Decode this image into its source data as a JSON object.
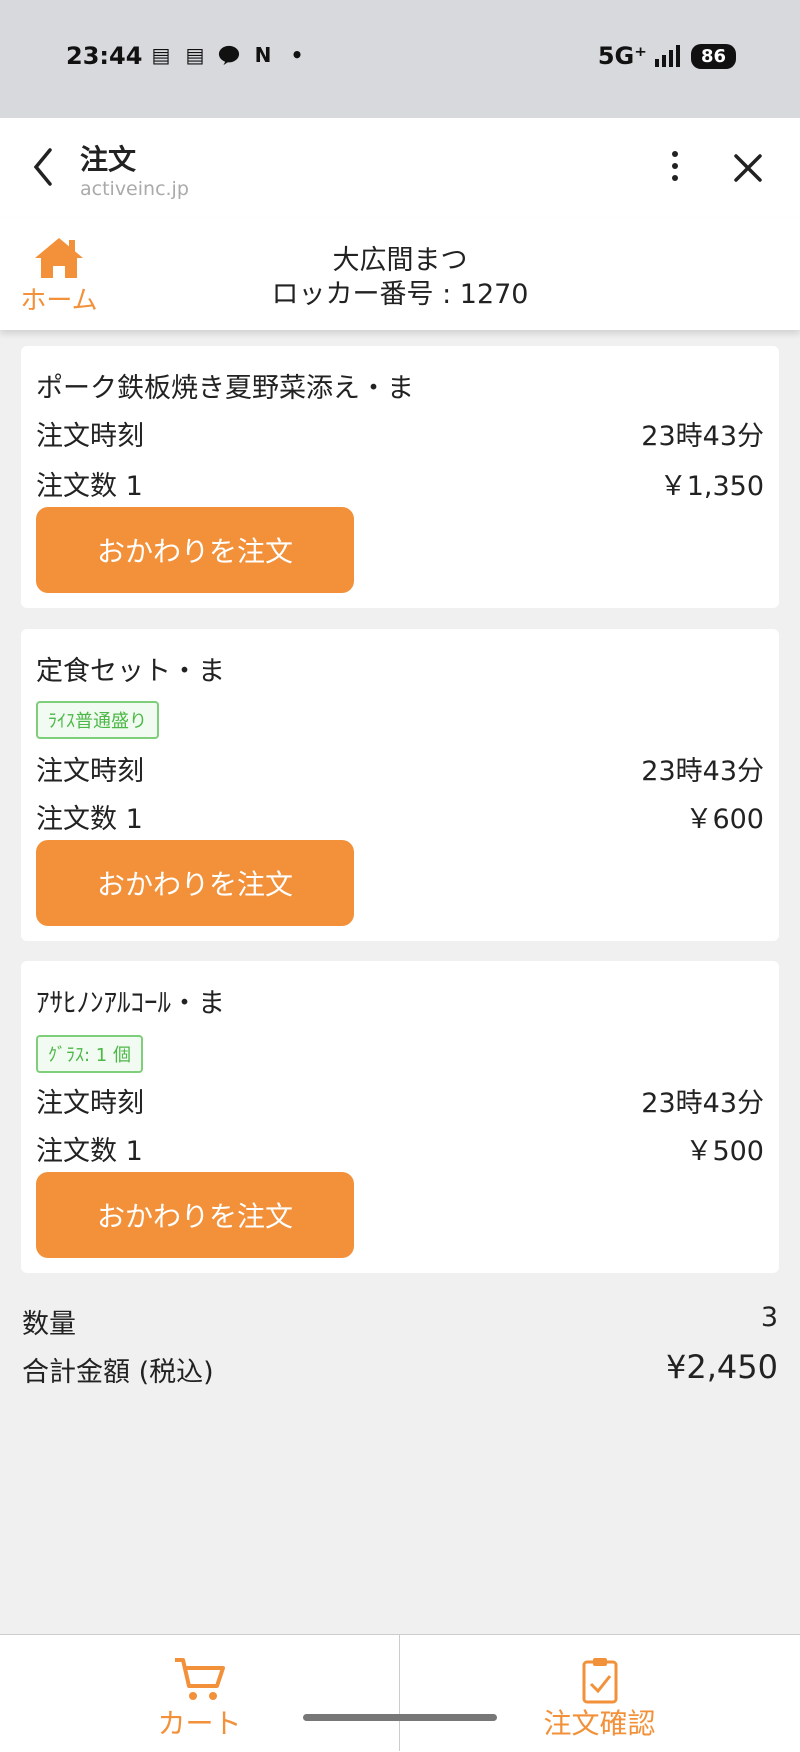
{
  "status_bar": {
    "time": "23:44",
    "network": "5G⁺",
    "battery": "86",
    "icons": [
      "news-icon",
      "news-icon",
      "line-icon",
      "netflix-icon",
      "dot-icon"
    ]
  },
  "browser": {
    "title": "注文",
    "url": "activeinc.jp"
  },
  "header": {
    "home_label": "ホーム",
    "store_name": "大広間まつ",
    "locker": "ロッカー番号 : 1270"
  },
  "labels": {
    "order_time": "注文時刻",
    "reorder": "おかわりを注文"
  },
  "orders": [
    {
      "name": "ポーク鉄板焼き夏野菜添え・ま",
      "tag": "",
      "time": "23時43分",
      "qty": "注文数 1",
      "price": "￥1,350"
    },
    {
      "name": "定食セット・ま",
      "tag": "ﾗｲｽ普通盛り",
      "time": "23時43分",
      "qty": "注文数 1",
      "price": "￥600"
    },
    {
      "name": "ｱｻﾋﾉﾝｱﾙｺｰﾙ・ま",
      "tag": "ｸﾞﾗｽ: 1 個",
      "time": "23時43分",
      "qty": "注文数 1",
      "price": "￥500"
    }
  ],
  "summary": {
    "qty_label": "数量",
    "qty_value": "3",
    "total_label": "合計金額 (税込)",
    "total_value": "¥2,450"
  },
  "bottom_nav": {
    "cart": "カート",
    "confirm": "注文確認"
  },
  "colors": {
    "accent": "#f2913a",
    "tag_green": "#4cb847"
  }
}
